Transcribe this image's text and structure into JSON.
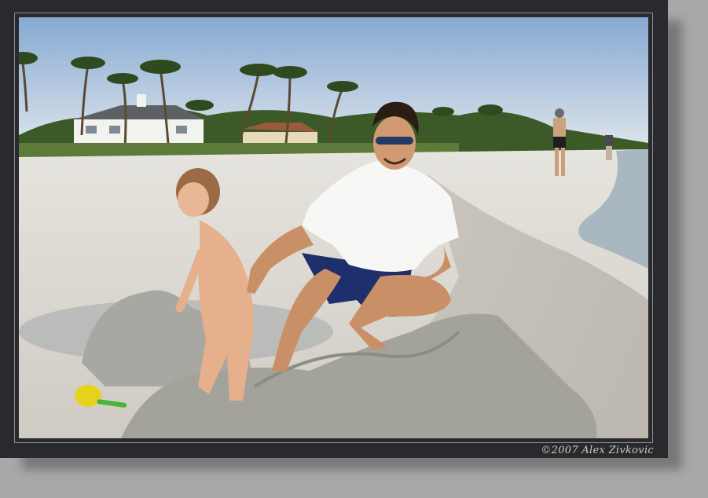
{
  "photo": {
    "description_alt": "",
    "copyright": "©2007 Alex Zivkovic"
  },
  "colors": {
    "frame": "#2a2a2e",
    "matte": "#a8a8a8",
    "sky_top": "#8fb1d6",
    "sky_bottom": "#d8e2ea",
    "sand": "#dcdcd8",
    "water": "#a9b8c0",
    "palm": "#2f4a1e"
  }
}
